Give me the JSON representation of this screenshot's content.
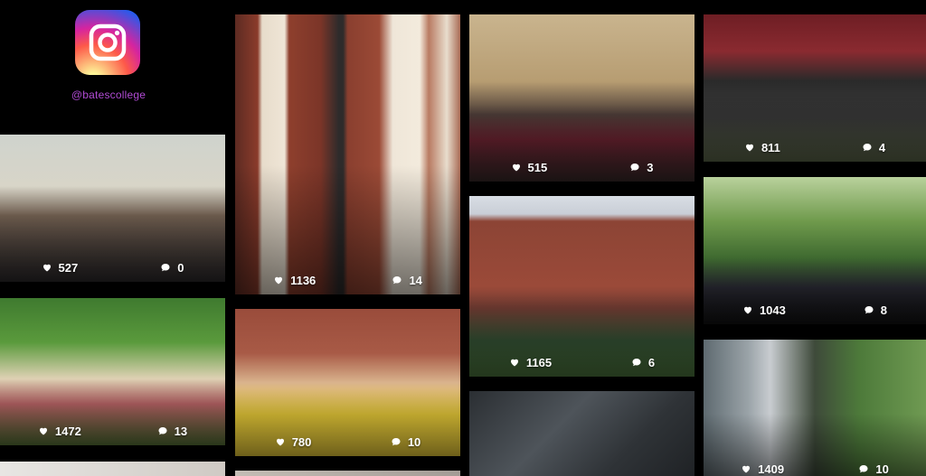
{
  "profile": {
    "handle": "@batescollege",
    "logo_icon": "instagram-icon"
  },
  "icons": {
    "likes": "heart-icon",
    "comments": "comment-icon"
  },
  "posts": [
    {
      "likes": "527",
      "comments": "0"
    },
    {
      "likes": "1472",
      "comments": "13"
    },
    {
      "likes": "1136",
      "comments": "14"
    },
    {
      "likes": "780",
      "comments": "10"
    },
    {
      "likes": "515",
      "comments": "3"
    },
    {
      "likes": "1165",
      "comments": "6"
    },
    {
      "likes": "811",
      "comments": "4"
    },
    {
      "likes": "1043",
      "comments": "8"
    },
    {
      "likes": "1409",
      "comments": "10"
    }
  ]
}
